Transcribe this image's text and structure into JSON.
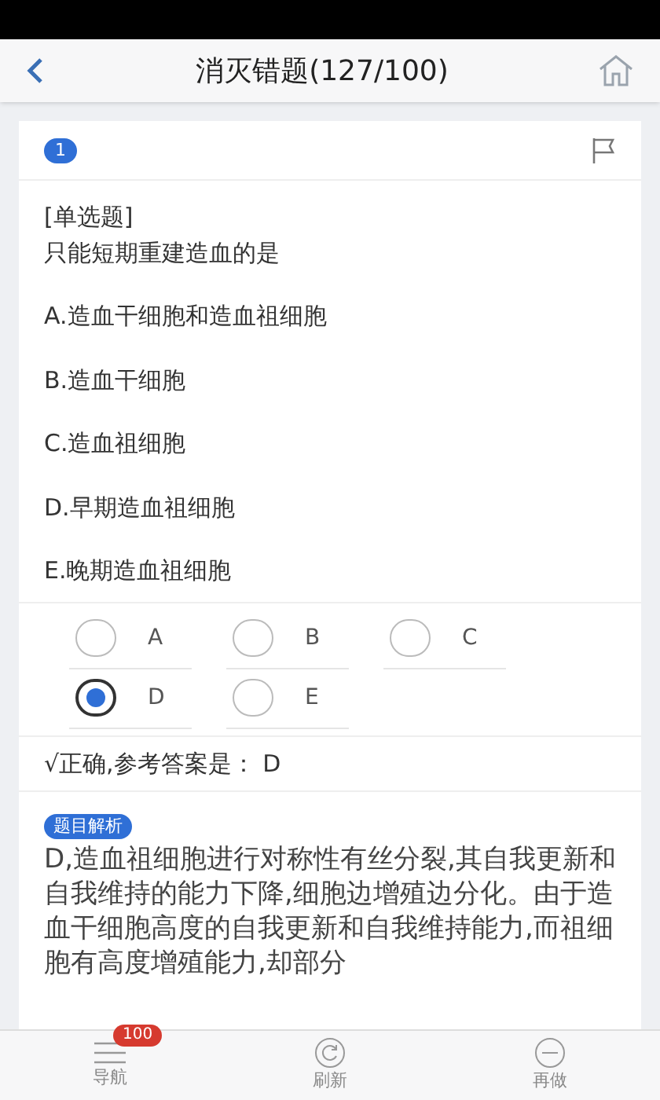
{
  "header": {
    "title": "消灭错题(127/100)"
  },
  "question": {
    "number": "1",
    "flagged": false,
    "type": "[单选题]",
    "stem": "只能短期重建造血的是",
    "options": [
      "A.造血干细胞和造血祖细胞",
      "B.造血干细胞",
      "C.造血祖细胞",
      "D.早期造血祖细胞",
      "E.晚期造血祖细胞"
    ]
  },
  "choices": [
    {
      "label": "A",
      "selected": false
    },
    {
      "label": "B",
      "selected": false
    },
    {
      "label": "C",
      "selected": false
    },
    {
      "label": "D",
      "selected": true
    },
    {
      "label": "E",
      "selected": false
    }
  ],
  "result": "√正确,参考答案是： D",
  "analysis": {
    "tag": "题目解析",
    "text": "D,造血祖细胞进行对称性有丝分裂,其自我更新和自我维持的能力下降,细胞边增殖边分化。由于造血干细胞高度的自我更新和自我维持能力,而祖细胞有高度增殖能力,却部分"
  },
  "tabbar": [
    {
      "kind": "nav",
      "label": "导航",
      "badge": "100"
    },
    {
      "kind": "refresh",
      "label": "刷新"
    },
    {
      "kind": "redo",
      "label": "再做"
    }
  ]
}
